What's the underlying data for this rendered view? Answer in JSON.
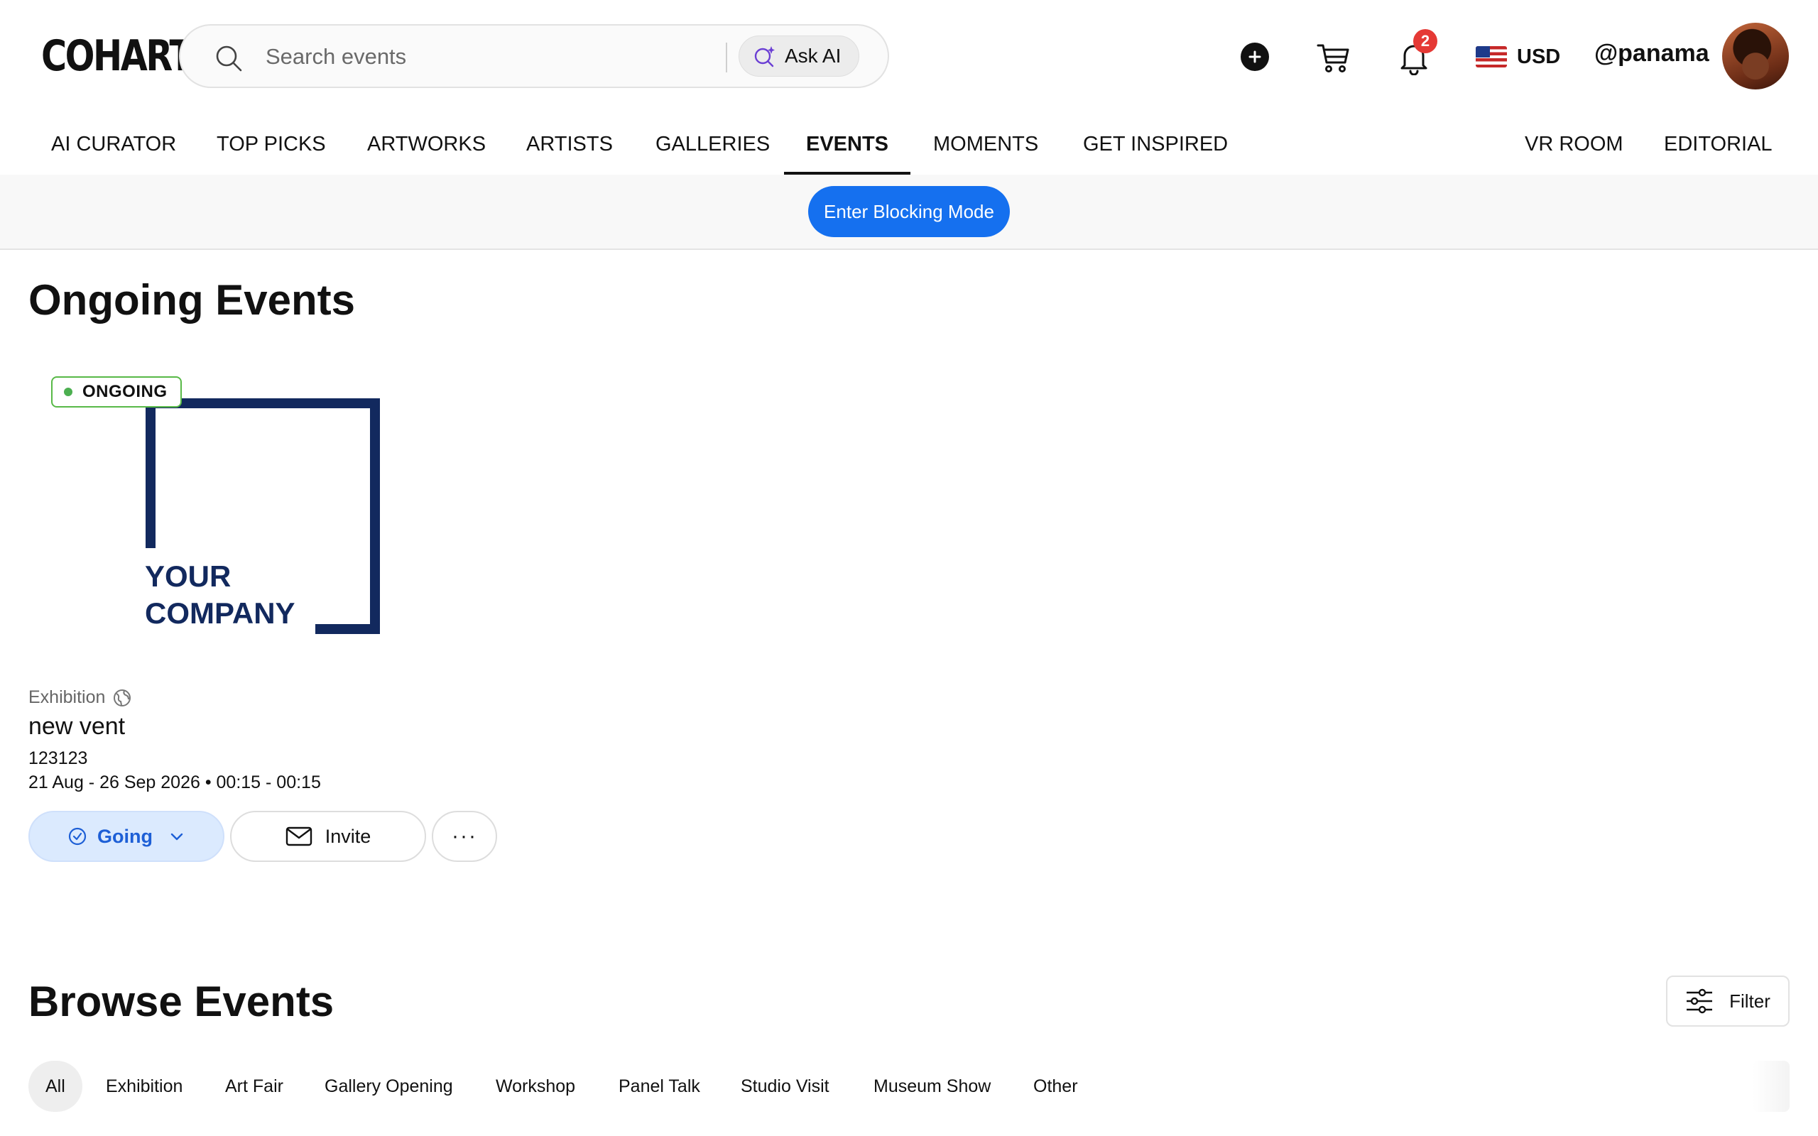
{
  "header": {
    "logo": "COHART",
    "search_placeholder": "Search events",
    "ask_ai_label": "Ask AI",
    "notification_count": "2",
    "currency": "USD",
    "username": "@panama"
  },
  "nav": {
    "items": [
      {
        "label": "AI CURATOR"
      },
      {
        "label": "TOP PICKS"
      },
      {
        "label": "ARTWORKS"
      },
      {
        "label": "ARTISTS"
      },
      {
        "label": "GALLERIES"
      },
      {
        "label": "EVENTS",
        "active": true
      },
      {
        "label": "MOMENTS"
      },
      {
        "label": "GET INSPIRED"
      },
      {
        "label": "VR ROOM"
      },
      {
        "label": "EDITORIAL"
      }
    ]
  },
  "blocking": {
    "button_label": "Enter Blocking Mode"
  },
  "ongoing": {
    "heading": "Ongoing Events",
    "event": {
      "badge": "ONGOING",
      "image_text_line1": "YOUR",
      "image_text_line2": "COMPANY",
      "type": "Exhibition",
      "title": "new vent",
      "description": "123123",
      "date": "21 Aug - 26 Sep 2026 • 00:15 - 00:15",
      "going_label": "Going",
      "invite_label": "Invite",
      "more_label": "···"
    }
  },
  "browse": {
    "heading": "Browse Events",
    "filter_label": "Filter",
    "categories": [
      {
        "label": "All",
        "active": true
      },
      {
        "label": "Exhibition"
      },
      {
        "label": "Art Fair"
      },
      {
        "label": "Gallery Opening"
      },
      {
        "label": "Workshop"
      },
      {
        "label": "Panel Talk"
      },
      {
        "label": "Studio Visit"
      },
      {
        "label": "Museum Show"
      },
      {
        "label": "Other"
      }
    ]
  },
  "colors": {
    "accent_blue": "#1570ef",
    "going_bg": "#dbeafe",
    "ongoing_green": "#4caf50",
    "logo_navy": "#12295e",
    "badge_red": "#e53935"
  }
}
